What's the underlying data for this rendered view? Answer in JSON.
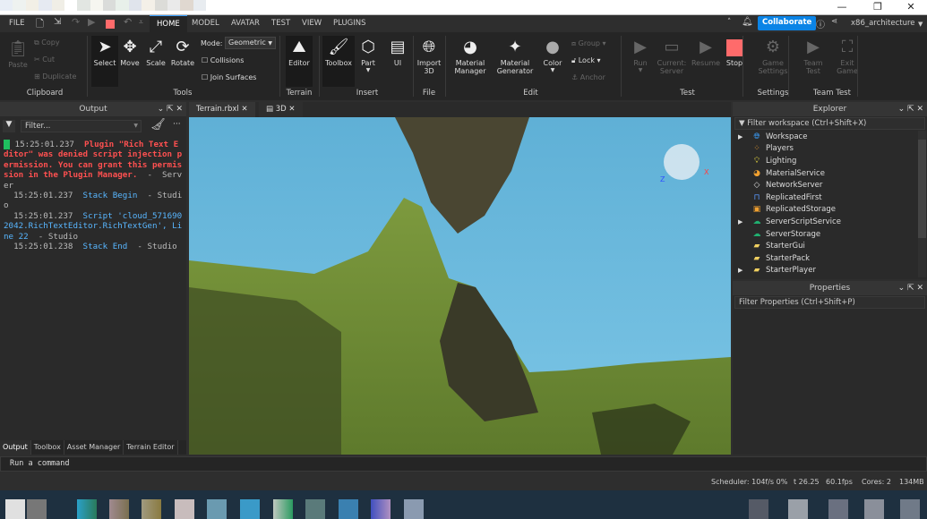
{
  "window": {
    "minimize_icon": "minimize-icon",
    "maximize_icon": "restore-icon",
    "close_icon": "close-icon"
  },
  "menubar": {
    "file": "FILE",
    "tabs": [
      "HOME",
      "MODEL",
      "AVATAR",
      "TEST",
      "VIEW",
      "PLUGINS"
    ],
    "active_tab": "HOME",
    "collaborate": "Collaborate",
    "user": "x86_architecture"
  },
  "ribbon": {
    "clipboard": {
      "paste": "Paste",
      "copy": "Copy",
      "cut": "Cut",
      "duplicate": "Duplicate",
      "group": "Clipboard"
    },
    "tools": {
      "select": "Select",
      "move": "Move",
      "scale": "Scale",
      "rotate": "Rotate",
      "mode_label": "Mode:",
      "mode_value": "Geometric",
      "collisions": "Collisions",
      "join_surfaces": "Join Surfaces",
      "group": "Tools"
    },
    "terrain": {
      "editor": "Editor",
      "group": "Terrain"
    },
    "insert": {
      "toolbox": "Toolbox",
      "part": "Part",
      "ui": "UI",
      "group": "Insert"
    },
    "file": {
      "import3d": "Import 3D",
      "group": "File"
    },
    "edit": {
      "material_manager": "Material Manager",
      "material_generator": "Material Generator",
      "color": "Color",
      "group_btn": "Group",
      "lock": "Lock",
      "anchor": "Anchor",
      "group": "Edit"
    },
    "test": {
      "run": "Run",
      "current": "Current: Server",
      "resume": "Resume",
      "stop": "Stop",
      "group": "Test"
    },
    "settings": {
      "game_settings": "Game Settings",
      "group": "Settings"
    },
    "team_test": {
      "team_test": "Team Test",
      "exit_game": "Exit Game",
      "group": "Team Test"
    },
    "colors": {
      "stop": "#ff6b6b",
      "accent": "#0b84e6"
    }
  },
  "output": {
    "title": "Output",
    "filter_placeholder": "Filter...",
    "lines": [
      {
        "time": "15:25:01.237",
        "msg": "Plugin \"Rich Text Editor\" was denied script injection permission. You can grant this permission in the Plugin Manager.",
        "source": "Server"
      },
      {
        "time": "15:25:01.237",
        "msg": "Stack Begin",
        "source": "Studio"
      },
      {
        "time": "15:25:01.237",
        "msg": "Script 'cloud_5716902042.RichTextEditor.RichTextGen', Line 22",
        "source": "Studio"
      },
      {
        "time": "15:25:01.238",
        "msg": "Stack End",
        "source": "Studio"
      }
    ]
  },
  "doc_tabs": [
    "Terrain.rbxl",
    "3D"
  ],
  "explorer": {
    "title": "Explorer",
    "filter": "Filter workspace (Ctrl+Shift+X)",
    "items": [
      "Workspace",
      "Players",
      "Lighting",
      "MaterialService",
      "NetworkServer",
      "ReplicatedFirst",
      "ReplicatedStorage",
      "ServerScriptService",
      "ServerStorage",
      "StarterGui",
      "StarterPack",
      "StarterPlayer"
    ]
  },
  "properties": {
    "title": "Properties",
    "filter": "Filter Properties (Ctrl+Shift+P)"
  },
  "bottom_tabs": [
    "Output",
    "Toolbox",
    "Asset Manager",
    "Terrain Editor"
  ],
  "command": {
    "placeholder": "Run a command"
  },
  "status": {
    "scheduler": "Scheduler: 104f/s 0%",
    "t": "t 26.25",
    "fps": "60.1fps",
    "cores": "Cores: 2",
    "mem": "134MB"
  },
  "viewcube": {
    "z": "Z",
    "x": "X"
  }
}
